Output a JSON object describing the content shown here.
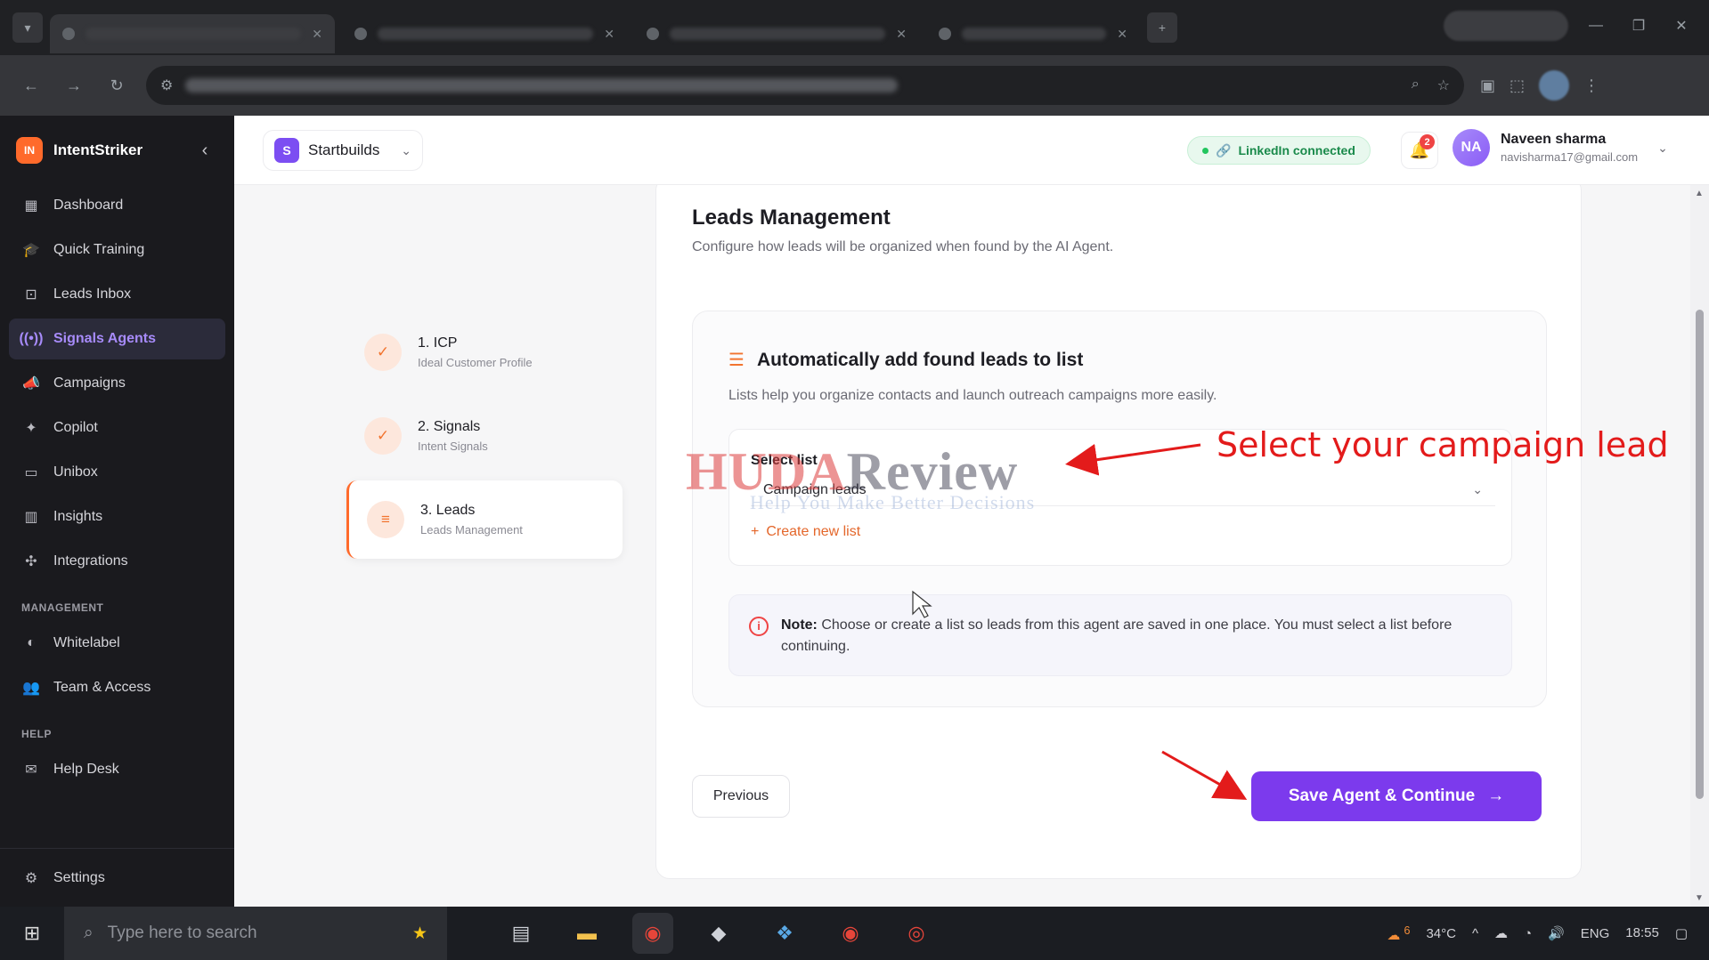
{
  "brand": {
    "name": "IntentStriker",
    "logo_text": "IN"
  },
  "sidebar": {
    "items": [
      {
        "label": "Dashboard",
        "icon": "grid-icon"
      },
      {
        "label": "Quick Training",
        "icon": "graduation-cap-icon"
      },
      {
        "label": "Leads Inbox",
        "icon": "inbox-icon"
      },
      {
        "label": "Signals Agents",
        "icon": "radio-signal-icon"
      },
      {
        "label": "Campaigns",
        "icon": "megaphone-icon"
      },
      {
        "label": "Copilot",
        "icon": "sparkles-icon"
      },
      {
        "label": "Unibox",
        "icon": "chat-icon"
      },
      {
        "label": "Insights",
        "icon": "bar-chart-icon"
      },
      {
        "label": "Integrations",
        "icon": "puzzle-icon"
      }
    ],
    "section_management": "MANAGEMENT",
    "management_items": [
      {
        "label": "Whitelabel",
        "icon": "palette-icon"
      },
      {
        "label": "Team & Access",
        "icon": "users-icon"
      }
    ],
    "section_help": "HELP",
    "help_items": [
      {
        "label": "Help Desk",
        "icon": "mail-icon"
      }
    ],
    "settings_label": "Settings",
    "active_index": 3
  },
  "header": {
    "workspace_badge": "S",
    "workspace_name": "Startbuilds",
    "linkedin_status": "LinkedIn connected",
    "notification_count": "2",
    "user_initials": "NA",
    "user_name": "Naveen sharma",
    "user_email": "navisharma17@gmail.com"
  },
  "steps": [
    {
      "title": "1. ICP",
      "subtitle": "Ideal Customer Profile",
      "state": "done"
    },
    {
      "title": "2. Signals",
      "subtitle": "Intent Signals",
      "state": "done"
    },
    {
      "title": "3. Leads",
      "subtitle": "Leads Management",
      "state": "active"
    }
  ],
  "card": {
    "title": "Leads Management",
    "description": "Configure how leads will be organized when found by the AI Agent.",
    "panel_title": "Automatically add found leads to list",
    "panel_description": "Lists help you organize contacts and launch outreach campaigns more easily.",
    "select_label": "Select list",
    "select_value": "Campaign leads",
    "create_new_list": "Create new list",
    "note_label": "Note:",
    "note_text": "Choose or create a list so leads from this agent are saved in one place. You must select a list before continuing.",
    "previous_label": "Previous",
    "save_label": "Save Agent & Continue"
  },
  "annotation": {
    "text": "Select your campaign lead",
    "watermark_main": "HUDA",
    "watermark_second": "Review",
    "watermark_sub": "Help You Make Better Decisions"
  },
  "taskbar": {
    "search_placeholder": "Type here to search",
    "temperature": "34°C",
    "language": "ENG",
    "time": "18:55",
    "weather_badge": "6"
  },
  "colors": {
    "accent": "#7c3aed",
    "brand_orange": "#ff6a2b",
    "annotation_red": "#e31b1b",
    "success_green": "#1a8a4b"
  }
}
